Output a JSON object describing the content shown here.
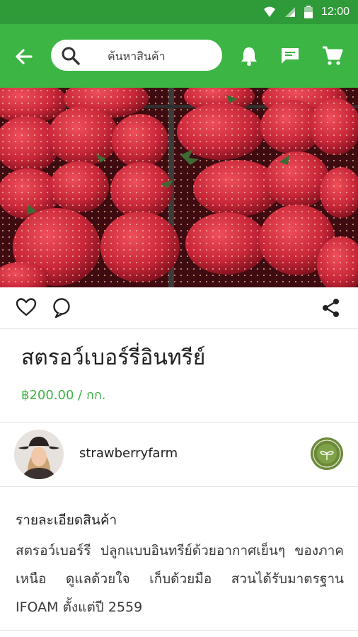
{
  "status_bar": {
    "time": "12:00"
  },
  "search": {
    "placeholder": "ค้นหาสินค้า"
  },
  "product": {
    "title": "สตรอว์เบอร์รี่อินทรีย์",
    "price": "฿200.00 / กก."
  },
  "seller": {
    "name": "strawberryfarm"
  },
  "description": {
    "heading": "รายละเอียดสินค้า",
    "body": "สตรอว์เบอร์รี ปลูกแบบอินทรีย์ด้วยอากาศเย็นๆ ของภาคเหนือ ดูแลด้วยใจ เก็บด้วยมือ สวนได้รับมาตรฐาน IFOAM ตั้งแต่ปี 2559"
  },
  "colors": {
    "primary": "#3cb544",
    "status_bar": "#2e9a38",
    "price": "#3cb544"
  },
  "icons": [
    "wifi-icon",
    "signal-icon",
    "battery-icon",
    "back-arrow-icon",
    "search-icon",
    "bell-icon",
    "chat-icon",
    "cart-icon",
    "heart-icon",
    "comment-icon",
    "share-icon",
    "organic-badge-icon"
  ]
}
